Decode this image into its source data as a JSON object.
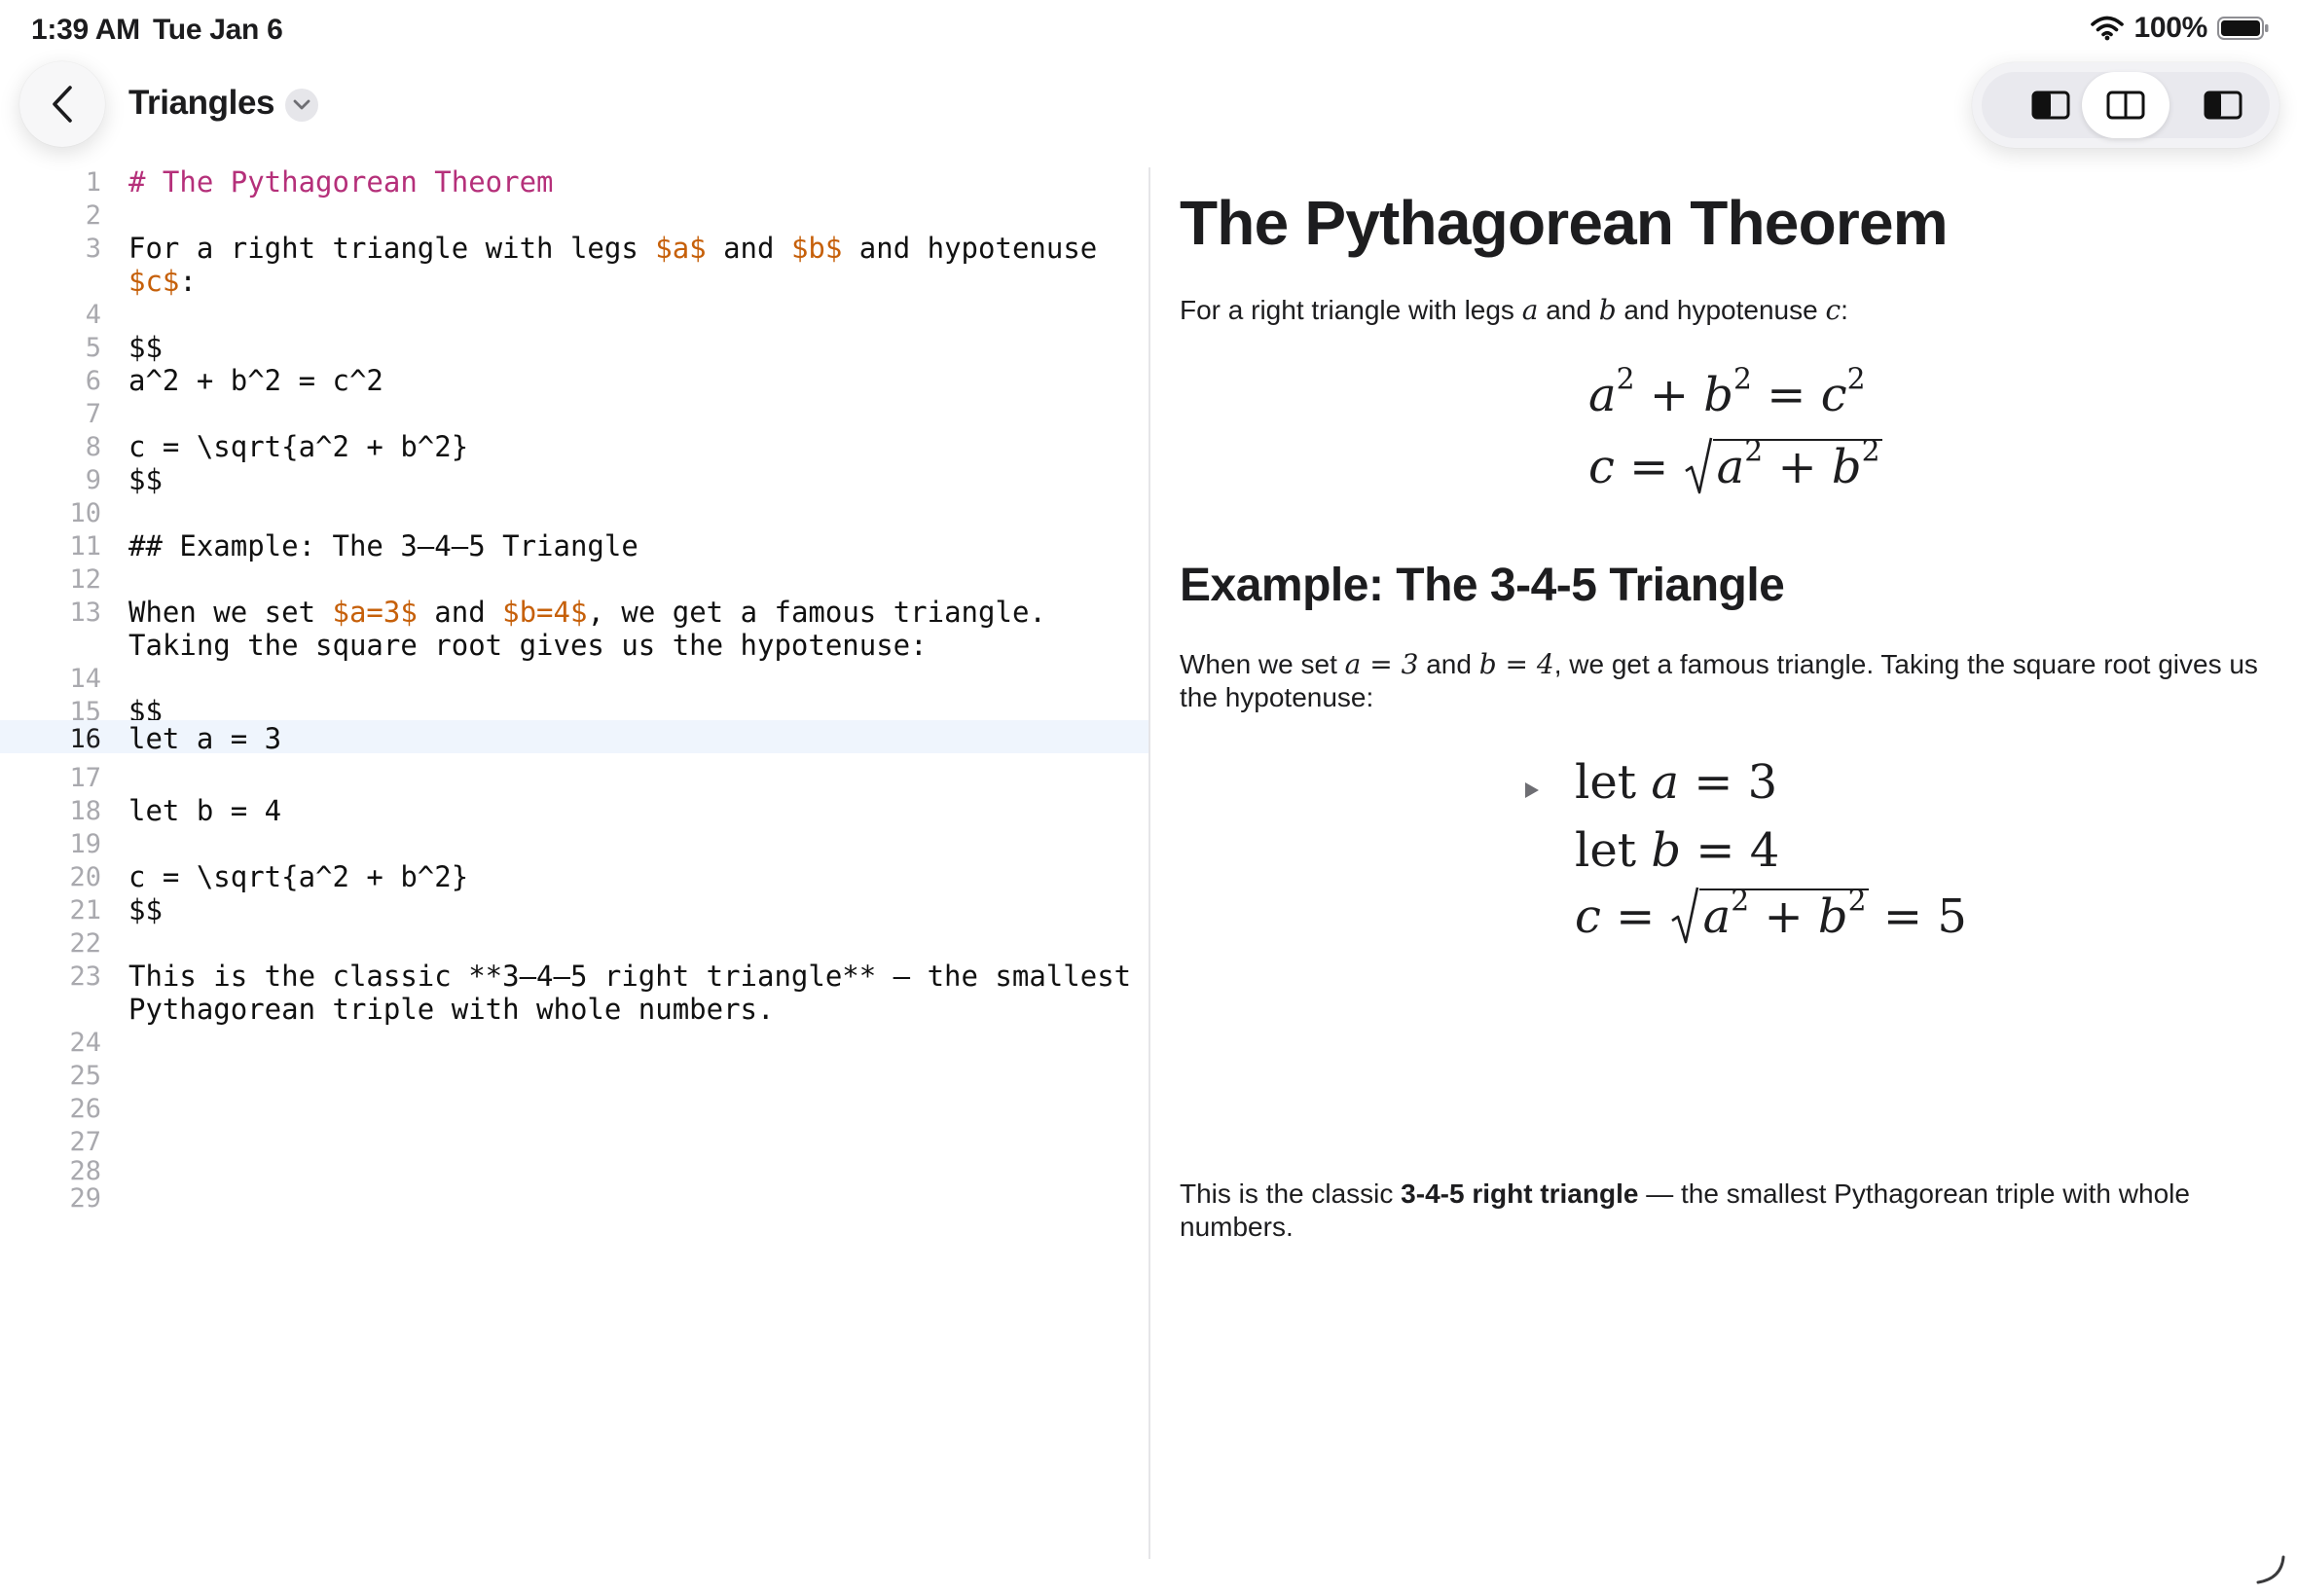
{
  "status_bar": {
    "time": "1:39 AM",
    "date": "Tue Jan 6",
    "battery": "100%"
  },
  "nav": {
    "title": "Triangles",
    "icons": [
      "chevron-left-icon",
      "chevron-down-icon",
      "sidebar-left-icon",
      "split-view-icon",
      "sidebar-right-icon"
    ]
  },
  "view_switcher": {
    "selected": "split"
  },
  "colors": {
    "heading": "#b5307a",
    "math": "#c6600a",
    "active_line": "#eff5fd",
    "line_number": "#a9a9ae"
  },
  "editor": {
    "active_line": 16,
    "line_numbers": [
      "1",
      "2",
      "3",
      "4",
      "5",
      "6",
      "7",
      "8",
      "9",
      "10",
      "11",
      "12",
      "13",
      "14",
      "15",
      "16",
      "17",
      "18",
      "19",
      "20",
      "21",
      "22",
      "23",
      "24",
      "25",
      "26",
      "27",
      "28",
      "29"
    ],
    "l1": "# The Pythagorean Theorem",
    "l3_a": "For a right triangle with legs ",
    "l3_b": "$a$",
    "l3_c": " and ",
    "l3_d": "$b$",
    "l3_e": " and hypotenuse",
    "l3w_a": "$c$",
    "l3w_b": ":",
    "l5": "$$",
    "l6": "a^2 + b^2 = c^2",
    "l8": "c = \\sqrt{a^2 + b^2}",
    "l9": "$$",
    "l11": "## Example: The 3–4–5 Triangle",
    "l13_a": "When we set ",
    "l13_b": "$a=3$",
    "l13_c": " and ",
    "l13_d": "$b=4$",
    "l13_e": ", we get a famous triangle.",
    "l13w": "Taking the square root gives us the hypotenuse:",
    "l15": "$$",
    "l16": "let a = 3",
    "l18": "let b = 4",
    "l20": "c = \\sqrt{a^2 + b^2}",
    "l21": "$$",
    "l23": "This is the classic **3–4–5 right triangle** — the smallest",
    "l23w": "Pythagorean triple with whole numbers."
  },
  "preview": {
    "h1": "The Pythagorean Theorem",
    "p1_a": "For a right triangle with legs ",
    "p1_var_a": "a",
    "p1_and": " and ",
    "p1_var_b": "b",
    "p1_b": " and hypotenuse ",
    "p1_var_c": "c",
    "p1_c": ":",
    "eq1": {
      "a": "a",
      "exp": "2",
      "plus": " + ",
      "b": "b",
      "eq": " = ",
      "c": "c"
    },
    "eq2": {
      "c": "c",
      "eq": " = ",
      "a": "a",
      "exp": "2",
      "plus": " + ",
      "b": "b"
    },
    "h2": "Example: The 3-4-5 Triangle",
    "p2_a": "When we set ",
    "p2_m1": "a = 3",
    "p2_and": " and ",
    "p2_m2": "b = 4",
    "p2_b": ", we get a famous triangle. Taking the square root gives us the hypotenuse:",
    "calc": {
      "let": "let",
      "a": "a",
      "b": "b",
      "c": "c",
      "eq": " = ",
      "val_a": "3",
      "val_b": "4",
      "exp": "2",
      "plus": " + ",
      "result": "5"
    },
    "p3_a": "This is the classic ",
    "p3_bold": "3-4-5 right triangle",
    "p3_b": " — the smallest Pythagorean triple with whole numbers."
  }
}
